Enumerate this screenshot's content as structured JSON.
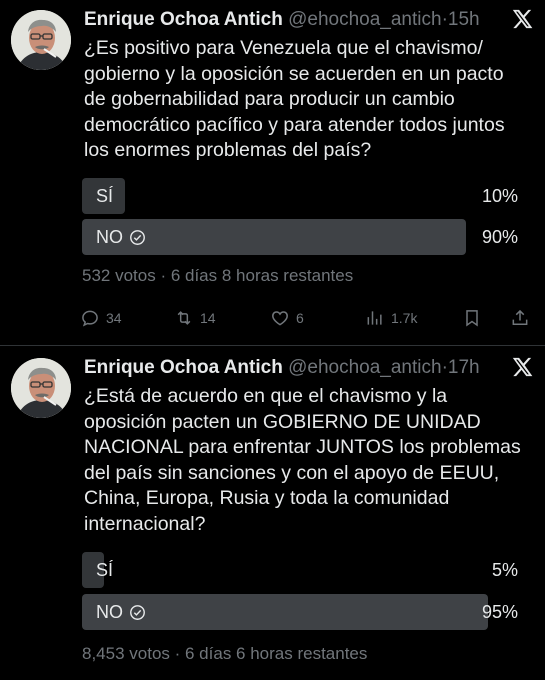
{
  "tweets": [
    {
      "author_name": "Enrique Ochoa Antich",
      "handle": "@ehochoa_antich",
      "separator": "·",
      "time": "15h",
      "text": "¿Es positivo para Venezuela que el chavismo/ gobierno y la oposición se acuerden en un pacto de gobernabilidad para producir un cambio democrático pacífico y para atender todos juntos los enormes problemas del país?",
      "poll": {
        "options": [
          {
            "label": "SÍ",
            "percent_label": "10%",
            "percent": 10,
            "winner": false
          },
          {
            "label": "NO",
            "percent_label": "90%",
            "percent": 90,
            "winner": true
          }
        ],
        "summary": "532 votos · 6 días 8 horas restantes"
      },
      "actions": {
        "replies": "34",
        "retweets": "14",
        "likes": "6",
        "views": "1.7k"
      }
    },
    {
      "author_name": "Enrique Ochoa Antich",
      "handle": "@ehochoa_antich",
      "separator": "·",
      "time": "17h",
      "text": "¿Está de acuerdo en que el chavismo y la oposición pacten un GOBIERNO DE UNIDAD NACIONAL para enfrentar JUNTOS los problemas del país sin sanciones y con el apoyo de EEUU, China, Europa, Rusia y toda la comunidad internacional?",
      "poll": {
        "options": [
          {
            "label": "SÍ",
            "percent_label": "5%",
            "percent": 5,
            "winner": false
          },
          {
            "label": "NO",
            "percent_label": "95%",
            "percent": 95,
            "winner": true
          }
        ],
        "summary": "8,453 votos · 6 días 6 horas restantes"
      }
    }
  ],
  "icons": {
    "platform": "x-logo-icon",
    "reply": "reply-icon",
    "retweet": "retweet-icon",
    "like": "heart-icon",
    "views": "views-icon",
    "bookmark": "bookmark-icon",
    "share": "share-icon",
    "vote": "check-circle-icon"
  },
  "colors": {
    "background": "#000000",
    "text": "#e7e9ea",
    "muted": "#71767b",
    "poll_bar": "#333639",
    "divider": "#2f3336"
  }
}
